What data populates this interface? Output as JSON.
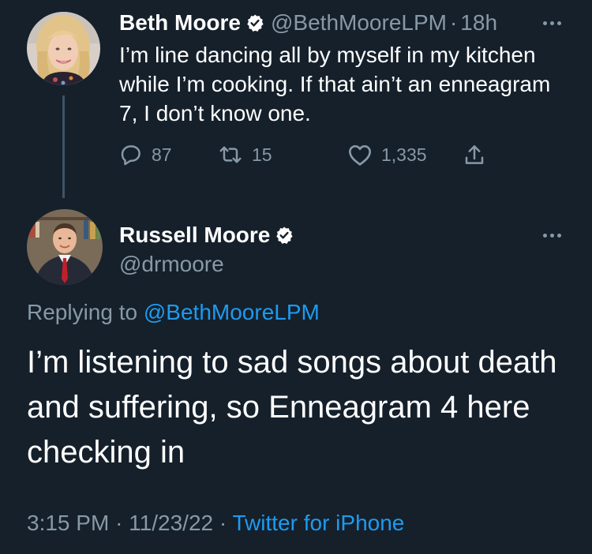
{
  "colors": {
    "background": "#15202b",
    "text": "#ffffff",
    "muted": "#8899a6",
    "link": "#1d9bf0",
    "thread_line": "#3d5466"
  },
  "parent_tweet": {
    "author_name": "Beth Moore",
    "handle": "@BethMooreLPM",
    "separator": "·",
    "time_ago": "18h",
    "text": "I’m line dancing all by myself in my kitchen while I’m cooking. If that ain’t an enneagram 7, I don’t know one.",
    "replies": "87",
    "retweets": "15",
    "likes": "1,335",
    "icons": [
      "verified-icon",
      "more-icon",
      "reply-icon",
      "retweet-icon",
      "like-icon",
      "share-icon"
    ]
  },
  "main_tweet": {
    "author_name": "Russell Moore",
    "handle": "@drmoore",
    "replying_prefix": "Replying to",
    "replying_to": "@BethMooreLPM",
    "text": "I’m listening to sad songs about death and suffering, so Enneagram 4 here checking in",
    "time": "3:15 PM",
    "date_sep": "·",
    "date": "11/23/22",
    "source_sep": "·",
    "source": "Twitter for iPhone",
    "icons": [
      "verified-icon",
      "more-icon"
    ]
  }
}
